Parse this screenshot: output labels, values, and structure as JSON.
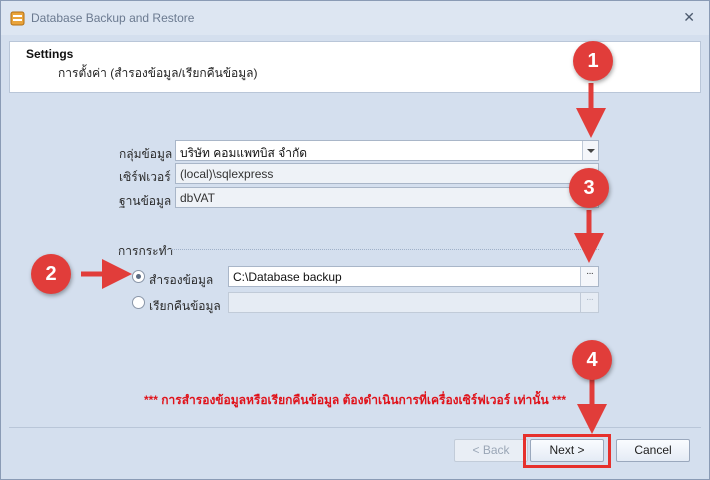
{
  "window": {
    "title": "Database Backup and Restore",
    "close_glyph": "✕"
  },
  "header": {
    "title": "Settings",
    "subtitle": "การตั้งค่า (สำรองข้อมูล/เรียกคืนข้อมูล)"
  },
  "form": {
    "group_label": "กลุ่มข้อมูล",
    "group_value": "บริษัท คอมแพทบิส จำกัด",
    "server_label": "เซิร์ฟเวอร์",
    "server_value": "(local)\\sqlexpress",
    "database_label": "ฐานข้อมูล",
    "database_value": "dbVAT"
  },
  "action": {
    "group_label": "การกระทำ",
    "backup_label": "สำรองข้อมูล",
    "backup_path": "C:\\Database backup",
    "restore_label": "เรียกคืนข้อมูล",
    "restore_path": "",
    "browse_glyph": "···",
    "selected": "backup"
  },
  "warning": "*** การสำรองข้อมูลหรือเรียกคืนข้อมูล ต้องดำเนินการที่เครื่องเซิร์ฟเวอร์ เท่านั้น ***",
  "buttons": {
    "back": "< Back",
    "next": "Next >",
    "cancel": "Cancel"
  },
  "annotations": {
    "badges": [
      "1",
      "2",
      "3",
      "4"
    ],
    "color": "#e13d3a"
  }
}
